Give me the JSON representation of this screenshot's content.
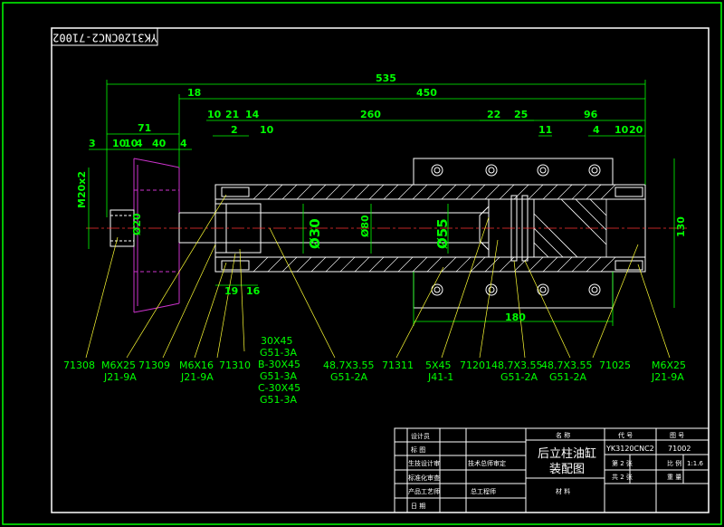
{
  "drawing_code": "YK3120CNC2-71002",
  "dimensions": {
    "top": [
      "535",
      "450",
      "18",
      "71",
      "10",
      "21",
      "14",
      "260",
      "22",
      "25",
      "96"
    ],
    "second_row": [
      "3",
      "10",
      "10",
      "4",
      "40",
      "4",
      "2",
      "10",
      "11",
      "4",
      "10",
      "20"
    ],
    "bottom": [
      "19",
      "16",
      "180"
    ],
    "vertical": [
      "M20x2",
      "130"
    ],
    "diameters": [
      "Ø20",
      "Ø30",
      "Ø80",
      "Ø55"
    ]
  },
  "callouts": [
    {
      "id": "c1",
      "top": "71308",
      "bottom": ""
    },
    {
      "id": "c2",
      "top": "M6X25",
      "bottom": "J21-9A"
    },
    {
      "id": "c3",
      "top": "71309",
      "bottom": ""
    },
    {
      "id": "c4",
      "top": "M6X16",
      "bottom": "J21-9A"
    },
    {
      "id": "c5",
      "top": "71310",
      "bottom": ""
    },
    {
      "id": "c6",
      "top": "48.7X3.55",
      "bottom": "G51-2A"
    },
    {
      "id": "c7",
      "top": "71311",
      "bottom": ""
    },
    {
      "id": "c8",
      "top": "5X45",
      "bottom": "J41-1"
    },
    {
      "id": "c9",
      "top": "71201",
      "bottom": ""
    },
    {
      "id": "c10",
      "top": "48.7X3.55",
      "bottom": "G51-2A"
    },
    {
      "id": "c11",
      "top": "48.7X3.55",
      "bottom": "G51-2A"
    },
    {
      "id": "c12",
      "top": "71025",
      "bottom": ""
    },
    {
      "id": "c13",
      "top": "M6X25",
      "bottom": "J21-9A"
    }
  ],
  "stacked_callout": [
    "30X45",
    "G51-3A",
    "B-30X45",
    "G51-3A",
    "C-30X45",
    "G51-3A"
  ],
  "title_block": {
    "left_labels": [
      "设计员",
      "标 图",
      "生技设计审",
      "标准化审查",
      "产品工艺师",
      "日 期"
    ],
    "mid_labels": [
      "技术总师审定",
      "总工程师"
    ],
    "name_header": "名 称",
    "name": "后立柱油缸",
    "name2": "装配图",
    "material_label": "材 料",
    "code_header": "代 号",
    "drawing_header": "图 号",
    "code": "YK3120CNC2",
    "drawing_no": "71002",
    "sheet": "第 2 张",
    "ratio_label": "比 例",
    "ratio": "1:1.6",
    "total": "共 2 张",
    "weight_label": "重 量"
  }
}
